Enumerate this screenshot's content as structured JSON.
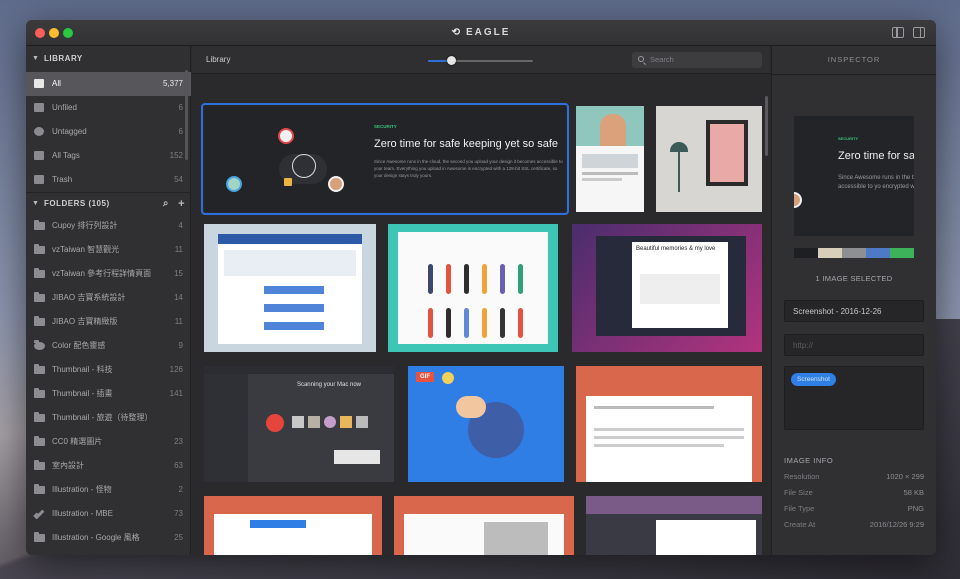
{
  "app": {
    "title": "EAGLE"
  },
  "sidebar": {
    "library_header": "LIBRARY",
    "library_items": [
      {
        "label": "All",
        "count": "5,377",
        "icon": "all-images-icon"
      },
      {
        "label": "Unfiled",
        "count": "6",
        "icon": "unfiled-icon"
      },
      {
        "label": "Untagged",
        "count": "6",
        "icon": "untagged-icon"
      },
      {
        "label": "All Tags",
        "count": "152",
        "icon": "tags-icon"
      },
      {
        "label": "Trash",
        "count": "54",
        "icon": "trash-icon"
      }
    ],
    "folders_header": "FOLDERS (105)",
    "folders": [
      {
        "label": "Cupoy 排行列設計",
        "count": "4"
      },
      {
        "label": "vzTaiwan 智慧觀光",
        "count": "11"
      },
      {
        "label": "vzTaiwan 參考行程詳情頁面",
        "count": "15"
      },
      {
        "label": "JIBAO 吉寶系統設計",
        "count": "14"
      },
      {
        "label": "JIBAO 吉寶精緻版",
        "count": "11"
      },
      {
        "label": "Color 配色靈感",
        "count": "9"
      },
      {
        "label": "Thumbnail - 科技",
        "count": "126"
      },
      {
        "label": "Thumbnail - 插畫",
        "count": "141"
      },
      {
        "label": "Thumbnail - 旅遊（待整理）",
        "count": ""
      },
      {
        "label": "CC0 精選圖片",
        "count": "23"
      },
      {
        "label": "室內設計",
        "count": "63"
      },
      {
        "label": "Illustration - 怪物",
        "count": "2"
      },
      {
        "label": "Illustration - MBE",
        "count": "73"
      },
      {
        "label": "Illustration - Google 風格",
        "count": "25"
      }
    ]
  },
  "toolbar": {
    "label": "Library",
    "zoom": 0.22,
    "search_placeholder": "Search"
  },
  "grid": {
    "selected_card": {
      "tag": "SECURITY",
      "headline": "Zero time for safe keeping yet so safe",
      "body": "Since Awesome runs in the cloud, the second you upload your design it becomes accessible to your team. Everything you upload in Awesome is encrypted with a 128-bit SSL certificate, so your design stays truly yours."
    },
    "card_texts": {
      "beautiful": "Beautiful memories & my love",
      "gif_badge": "GIF",
      "scan_title": "Scanning your Mac now"
    }
  },
  "inspector": {
    "title": "INSPECTOR",
    "preview": {
      "tag": "SECURITY",
      "headline": "Zero time for sa",
      "body": "Since Awesome runs in the becomes accessible to yo encrypted with a 128-bit S"
    },
    "palette": [
      "#1e1f22",
      "#d9cfb8",
      "#8d8f93",
      "#4d79c6",
      "#3db25a"
    ],
    "selected_count": "1 IMAGE SELECTED",
    "name_value": "Screenshot - 2016-12-26",
    "url_placeholder": "http://",
    "tags": [
      "Screenshot"
    ],
    "info_header": "IMAGE INFO",
    "info": [
      {
        "label": "Resolution",
        "value": "1020 × 299"
      },
      {
        "label": "File Size",
        "value": "58 KB"
      },
      {
        "label": "File Type",
        "value": "PNG"
      },
      {
        "label": "Create At",
        "value": "2016/12/26 9:29"
      }
    ]
  }
}
